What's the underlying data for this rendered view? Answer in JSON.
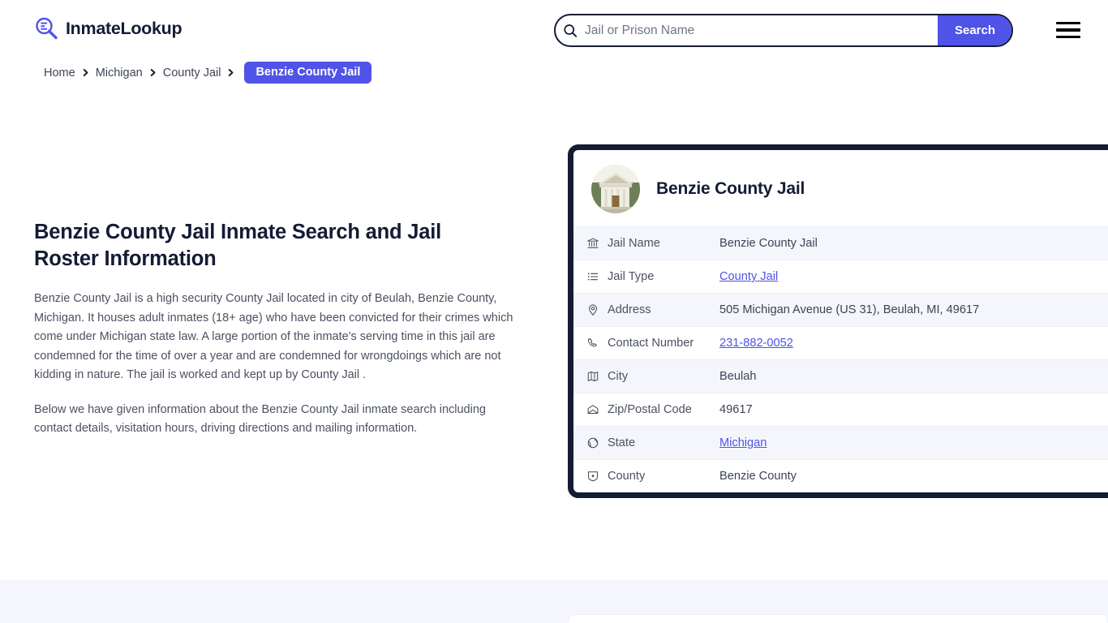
{
  "header": {
    "brand_name": "InmateLookup",
    "brand_icon": "magnifier-list-logo-icon",
    "search": {
      "placeholder": "Jail or Prison Name",
      "value": "",
      "icon": "search-icon",
      "button_label": "Search"
    },
    "menu_icon": "hamburger-menu-icon"
  },
  "breadcrumb": {
    "items": [
      {
        "label": "Home"
      },
      {
        "label": "Michigan"
      },
      {
        "label": "County Jail"
      }
    ],
    "current": "Benzie County Jail",
    "separator_icon": "chevron-right-icon"
  },
  "main": {
    "title": "Benzie County Jail Inmate Search and Jail Roster Information",
    "paragraph_1": "Benzie County Jail is a high security County Jail located in city of Beulah, Benzie County, Michigan. It houses adult inmates (18+ age) who have been convicted for their crimes which come under Michigan state law. A large portion of the inmate's serving time in this jail are condemned for the time of over a year and are condemned for wrongdoings which are not kidding in nature. The jail is worked and kept up by County Jail .",
    "paragraph_2": "Below we have given information about the Benzie County Jail inmate search including contact details, visitation hours, driving directions and mailing information."
  },
  "card": {
    "photo_icon": "courthouse-photo",
    "title": "Benzie County Jail",
    "rows": [
      {
        "icon": "bank-icon",
        "label": "Jail Name",
        "value": "Benzie County Jail",
        "link": false
      },
      {
        "icon": "list-icon",
        "label": "Jail Type",
        "value": "County Jail",
        "link": true
      },
      {
        "icon": "map-pin-icon",
        "label": "Address",
        "value": "505 Michigan Avenue (US 31), Beulah, MI, 49617",
        "link": false
      },
      {
        "icon": "phone-icon",
        "label": "Contact Number",
        "value": "231-882-0052",
        "link": true
      },
      {
        "icon": "map-icon",
        "label": "City",
        "value": "Beulah",
        "link": false
      },
      {
        "icon": "envelope-icon",
        "label": "Zip/Postal Code",
        "value": "49617",
        "link": false
      },
      {
        "icon": "globe-icon",
        "label": "State",
        "value": "Michigan",
        "link": true
      },
      {
        "icon": "shield-icon",
        "label": "County",
        "value": "Benzie County",
        "link": false
      }
    ]
  },
  "colors": {
    "accent": "#4f53e8",
    "dark": "#141b34",
    "row_alt": "#f5f6fc",
    "band": "#f5f5fd"
  }
}
